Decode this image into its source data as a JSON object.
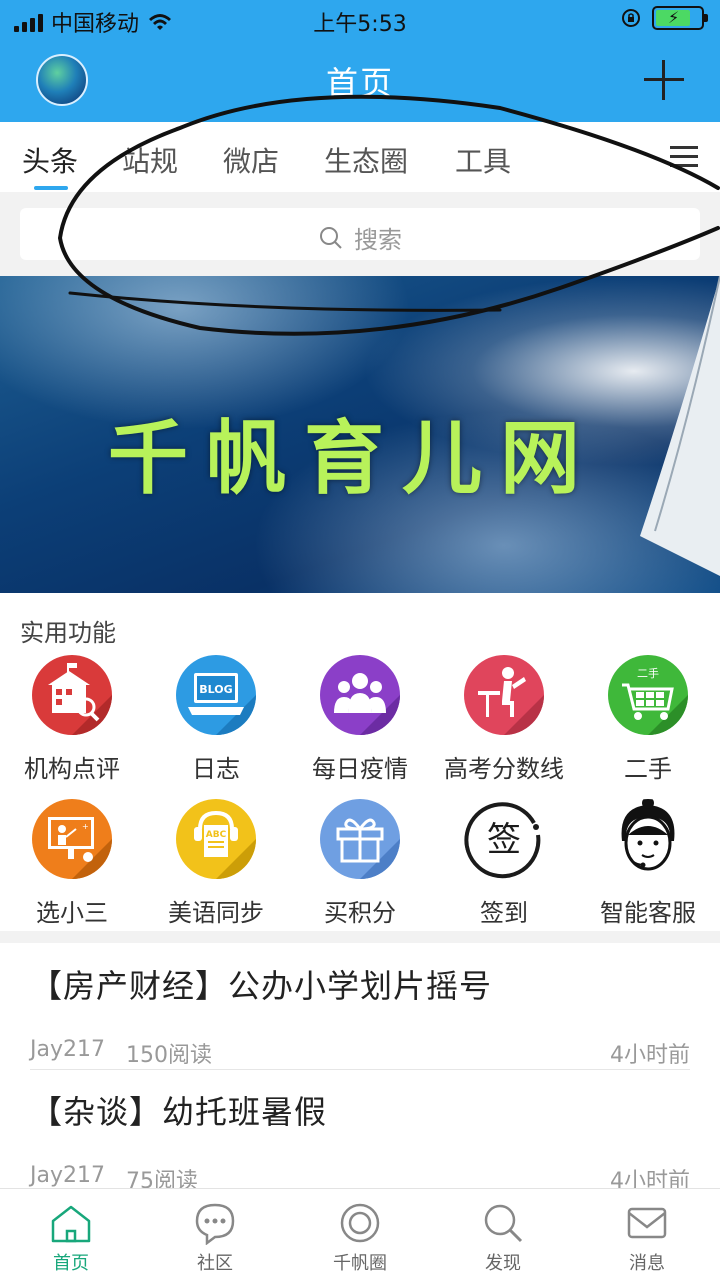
{
  "status_bar": {
    "carrier": "中国移动",
    "time": "上午5:53"
  },
  "header": {
    "title": "首页",
    "avatar_icon": "avatar-image",
    "add_icon": "plus-icon"
  },
  "tabs": {
    "items": [
      {
        "label": "头条",
        "active": true
      },
      {
        "label": "站规",
        "active": false
      },
      {
        "label": "微店",
        "active": false
      },
      {
        "label": "生态圈",
        "active": false
      },
      {
        "label": "工具",
        "active": false
      }
    ],
    "menu_icon": "hamburger-menu-icon"
  },
  "search": {
    "placeholder": "搜索"
  },
  "banner": {
    "text": "千帆育儿网"
  },
  "features": {
    "title": "实用功能",
    "items": [
      {
        "label": "机构点评",
        "icon": "school-icon",
        "color": "#d93a3a"
      },
      {
        "label": "日志",
        "icon": "blog-laptop-icon",
        "color": "#2d9be3"
      },
      {
        "label": "每日疫情",
        "icon": "people-group-icon",
        "color": "#8b3fc8"
      },
      {
        "label": "高考分数线",
        "icon": "student-desk-icon",
        "color": "#e0455c"
      },
      {
        "label": "二手",
        "icon": "shopping-cart-icon",
        "color": "#3fb83a"
      },
      {
        "label": "选小三",
        "icon": "teacher-board-icon",
        "color": "#ef7e1b"
      },
      {
        "label": "美语同步",
        "icon": "abc-book-icon",
        "color": "#f2c21a"
      },
      {
        "label": "买积分",
        "icon": "gift-box-icon",
        "color": "#6f9fe2"
      },
      {
        "label": "签到",
        "icon": "checkin-icon",
        "color": "#1b1b1b"
      },
      {
        "label": "智能客服",
        "icon": "customer-service-icon",
        "color": "#111111"
      }
    ]
  },
  "articles": [
    {
      "title": "【房产财经】公办小学划片摇号",
      "author": "Jay217",
      "reads": "150阅读",
      "ago": "4小时前"
    },
    {
      "title": "【杂谈】幼托班暑假",
      "author": "Jay217",
      "reads": "75阅读",
      "ago": "4小时前"
    }
  ],
  "bottom_nav": {
    "items": [
      {
        "label": "首页",
        "icon": "home-icon",
        "active": true
      },
      {
        "label": "社区",
        "icon": "chat-bubble-icon",
        "active": false
      },
      {
        "label": "千帆圈",
        "icon": "circle-icon",
        "active": false
      },
      {
        "label": "发现",
        "icon": "search-icon",
        "active": false
      },
      {
        "label": "消息",
        "icon": "mail-icon",
        "active": false
      }
    ],
    "active_color": "#18a77b"
  },
  "colors": {
    "brand": "#2ea7ee",
    "banner_text": "#b8f25a"
  }
}
